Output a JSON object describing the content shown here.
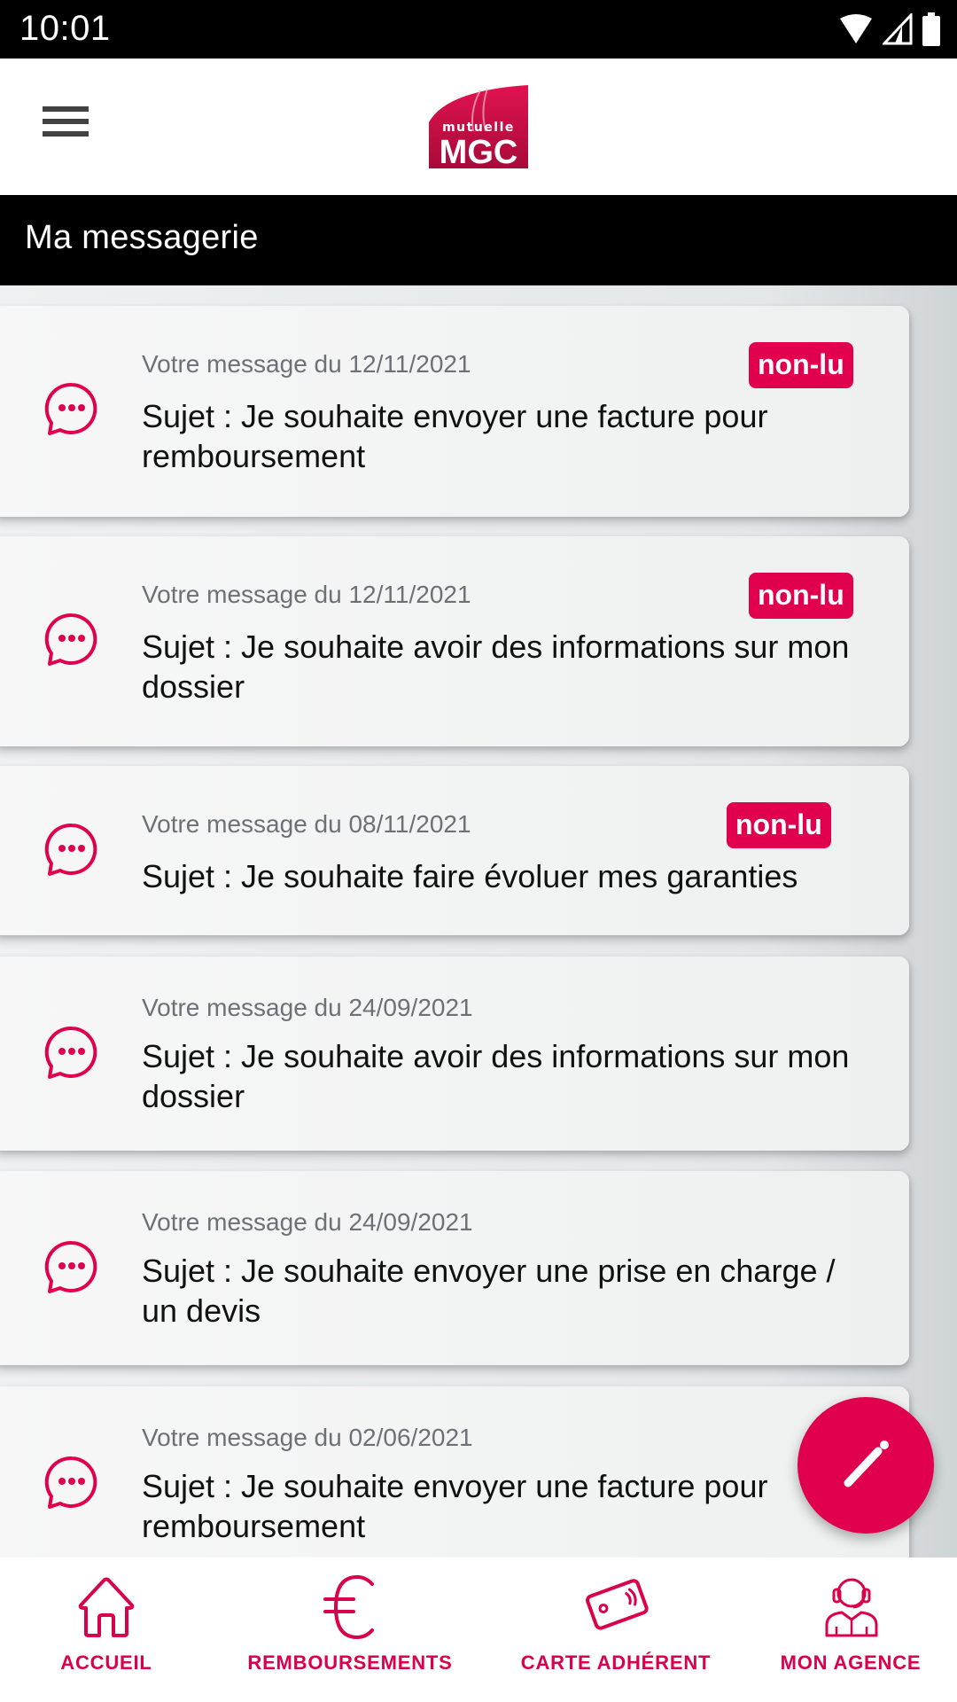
{
  "status_bar": {
    "time": "10:01",
    "icons": [
      "wifi-icon",
      "signal-icon",
      "battery-icon"
    ]
  },
  "app_bar": {
    "menu_icon": "hamburger-menu-icon",
    "logo": {
      "line1": "mutuelle",
      "line2": "MGC"
    }
  },
  "page": {
    "title": "Ma messagerie"
  },
  "colors": {
    "accent": "#e0004d",
    "title_bar": "#000000",
    "date_text": "#6d7175"
  },
  "messages": [
    {
      "date": "Votre message du 12/11/2021",
      "subject": "Sujet : Je souhaite envoyer une facture pour remboursement",
      "badge": "non-lu",
      "icon": "chat-bubble-icon"
    },
    {
      "date": "Votre message du 12/11/2021",
      "subject": "Sujet : Je souhaite avoir des informations sur mon dossier",
      "badge": "non-lu",
      "icon": "chat-bubble-icon"
    },
    {
      "date": "Votre message du 08/11/2021",
      "subject": "Sujet : Je souhaite faire évoluer mes garanties",
      "badge": "non-lu",
      "icon": "chat-bubble-icon"
    },
    {
      "date": "Votre message du 24/09/2021",
      "subject": "Sujet : Je souhaite avoir des informations sur mon dossier",
      "badge": null,
      "icon": "chat-bubble-icon"
    },
    {
      "date": "Votre message du 24/09/2021",
      "subject": "Sujet : Je souhaite envoyer une prise en charge / un devis",
      "badge": null,
      "icon": "chat-bubble-icon"
    },
    {
      "date": "Votre message du 02/06/2021",
      "subject": "Sujet : Je souhaite envoyer une facture pour remboursement",
      "badge": null,
      "icon": "chat-bubble-icon"
    }
  ],
  "fab": {
    "icon": "pencil-icon",
    "action": "new-message"
  },
  "bottom_nav": [
    {
      "label": "ACCUEIL",
      "icon": "home-icon"
    },
    {
      "label": "REMBOURSEMENTS",
      "icon": "euro-icon"
    },
    {
      "label": "CARTE ADHÉRENT",
      "icon": "card-icon"
    },
    {
      "label": "MON AGENCE",
      "icon": "agent-headset-icon"
    }
  ]
}
